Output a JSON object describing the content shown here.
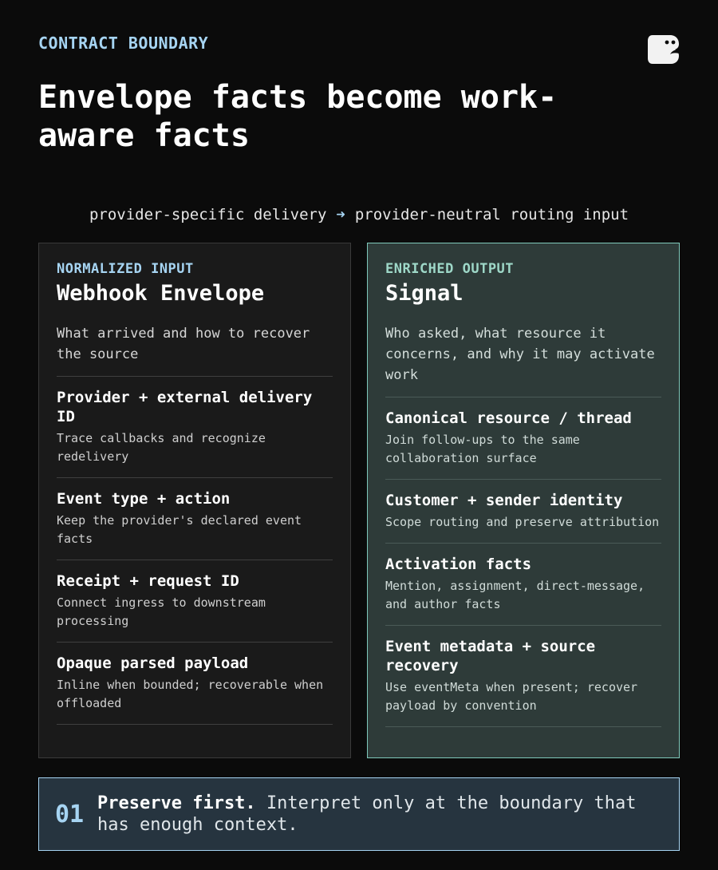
{
  "header": {
    "eyebrow": "CONTRACT BOUNDARY",
    "title": "Envelope facts become work-aware facts",
    "logo_icon": "ghost-mascot-icon"
  },
  "flow": {
    "from": "provider-specific delivery",
    "arrow": "➜",
    "to": "provider-neutral routing input"
  },
  "left_panel": {
    "kicker": "NORMALIZED INPUT",
    "heading": "Webhook Envelope",
    "description": "What arrived and how to recover the source",
    "items": [
      {
        "title": "Provider + external delivery ID",
        "text": "Trace callbacks and recognize redelivery"
      },
      {
        "title": "Event type + action",
        "text": "Keep the provider's declared event facts"
      },
      {
        "title": "Receipt + request ID",
        "text": "Connect ingress to downstream processing"
      },
      {
        "title": "Opaque parsed payload",
        "text": "Inline when bounded; recoverable when offloaded"
      }
    ]
  },
  "right_panel": {
    "kicker": "ENRICHED OUTPUT",
    "heading": "Signal",
    "description": "Who asked, what resource it concerns, and why it may activate work",
    "items": [
      {
        "title": "Canonical resource / thread",
        "text": "Join follow-ups to the same collaboration surface"
      },
      {
        "title": "Customer + sender identity",
        "text": "Scope routing and preserve attribution"
      },
      {
        "title": "Activation facts",
        "text": "Mention, assignment, direct-message, and author facts"
      },
      {
        "title": "Event metadata + source recovery",
        "text": "Use eventMeta when present; recover payload by convention"
      }
    ]
  },
  "callout": {
    "number": "01",
    "strong": "Preserve first.",
    "text": "Interpret only at the boundary that has enough context."
  },
  "colors": {
    "background": "#0b0b0b",
    "accent_blue": "#a6d4f2",
    "accent_teal": "#9ed8c8",
    "right_panel_bg": "#2e3b39"
  }
}
